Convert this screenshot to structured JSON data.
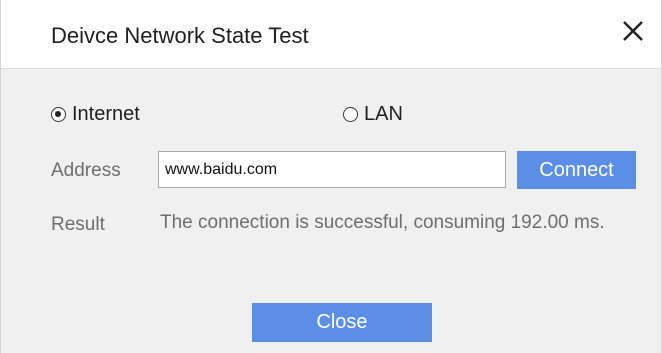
{
  "dialog": {
    "title": "Deivce Network State Test",
    "close_icon": "close-icon"
  },
  "mode": {
    "options": [
      {
        "label": "Internet",
        "selected": true
      },
      {
        "label": "LAN",
        "selected": false
      }
    ]
  },
  "address": {
    "label": "Address",
    "value": "www.baidu.com"
  },
  "connect_button": "Connect",
  "result": {
    "label": "Result",
    "text": "The connection is successful, consuming 192.00 ms."
  },
  "close_button": "Close",
  "colors": {
    "accent": "#5b8fe6",
    "background": "#f0f0f0"
  }
}
